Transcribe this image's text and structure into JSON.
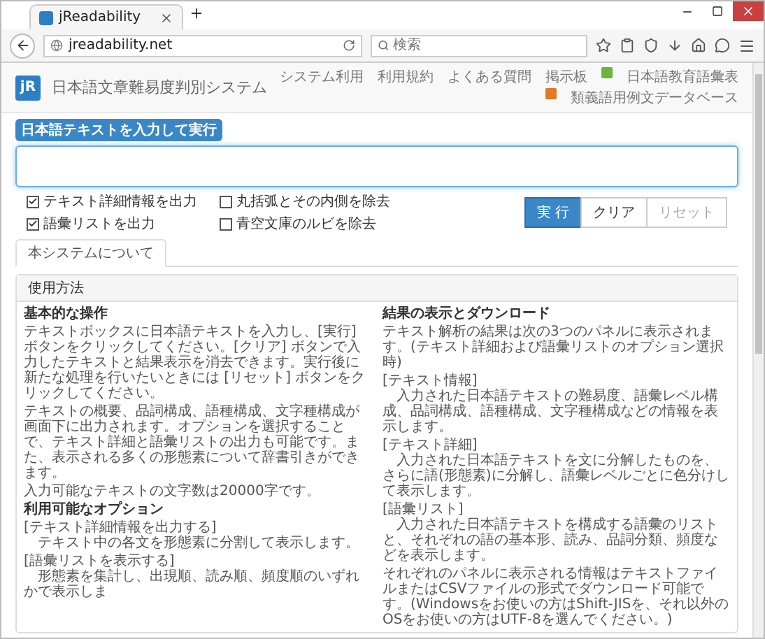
{
  "browser": {
    "tab": {
      "title": "jReadability",
      "selected": true
    },
    "address": "jreadability.net",
    "search": {
      "placeholder": "検索"
    }
  },
  "header": {
    "logo": "jR",
    "title": "日本語文章難易度判別システム",
    "nav": [
      {
        "label": "システム利用",
        "kind": "link"
      },
      {
        "label": "利用規約",
        "kind": "link"
      },
      {
        "label": "よくある質問",
        "kind": "link"
      },
      {
        "label": "掲示板",
        "kind": "link"
      },
      {
        "label": "日本語教育語彙表",
        "kind": "external",
        "color": "#6db33f"
      },
      {
        "label": "類義語用例文データベース",
        "kind": "external",
        "color": "#e07b24"
      }
    ]
  },
  "form": {
    "label": "日本語テキストを入力して実行",
    "checkboxes": [
      {
        "label": "テキスト詳細情報を出力",
        "checked": true
      },
      {
        "label": "丸括弧とその内側を除去",
        "checked": false
      },
      {
        "label": "語彙リストを出力",
        "checked": true
      },
      {
        "label": "青空文庫のルビを除去",
        "checked": false
      }
    ],
    "buttons": [
      {
        "label": "実 行",
        "kind": "primary",
        "disabled": false
      },
      {
        "label": "クリア",
        "kind": "default",
        "disabled": false
      },
      {
        "label": "リセット",
        "kind": "default",
        "disabled": true
      }
    ]
  },
  "tabs": [
    {
      "label": "本システムについて",
      "selected": true
    }
  ],
  "panel": {
    "title": "使用方法",
    "columns": [
      {
        "blocks": [
          {
            "kind": "heading",
            "text": "基本的な操作"
          },
          {
            "kind": "paragraph",
            "text": "テキストボックスに日本語テキストを入力し、[実行] ボタンをクリックしてください。[クリア] ボタンで入力したテキストと結果表示を消去できます。実行後に新たな処理を行いたいときには [リセット] ボタンをクリックしてください。"
          },
          {
            "kind": "paragraph",
            "text": "テキストの概要、品詞構成、語種構成、文字種構成が画面下に出力されます。オプションを選択することで、テキスト詳細と語彙リストの出力も可能です。また、表示される多くの形態素について辞書引きができます。"
          },
          {
            "kind": "paragraph",
            "text": "入力可能なテキストの文字数は20000字です。"
          },
          {
            "kind": "heading",
            "text": "利用可能なオプション"
          },
          {
            "kind": "entry",
            "title": "[テキスト詳細情報を出力する]",
            "text": "テキスト中の各文を形態素に分割して表示します。"
          },
          {
            "kind": "entry",
            "title": "[語彙リストを表示する]",
            "text": "形態素を集計し、出現順、読み順、頻度順のいずれかで表示しま"
          }
        ]
      },
      {
        "blocks": [
          {
            "kind": "heading",
            "text": "結果の表示とダウンロード"
          },
          {
            "kind": "paragraph",
            "text": "テキスト解析の結果は次の3つのパネルに表示されます。(テキスト詳細および語彙リストのオプション選択時)"
          },
          {
            "kind": "entry",
            "title": "[テキスト情報]",
            "text": "入力された日本語テキストの難易度、語彙レベル構成、品詞構成、語種構成、文字種構成などの情報を表示します。"
          },
          {
            "kind": "entry",
            "title": "[テキスト詳細]",
            "text": "入力された日本語テキストを文に分解したものを、さらに語(形態素)に分解し、語彙レベルごとに色分けして表示します。"
          },
          {
            "kind": "entry",
            "title": "[語彙リスト]",
            "text": "入力された日本語テキストを構成する語彙のリストと、それぞれの語の基本形、読み、品詞分類、頻度などを表示します。"
          },
          {
            "kind": "paragraph",
            "text": "それぞれのパネルに表示される情報はテキストファイルまたはCSVファイルの形式でダウンロード可能です。(Windowsをお使いの方はShift-JISを、それ以外のOSをお使いの方はUTF-8を選んでください。)"
          }
        ]
      }
    ]
  }
}
